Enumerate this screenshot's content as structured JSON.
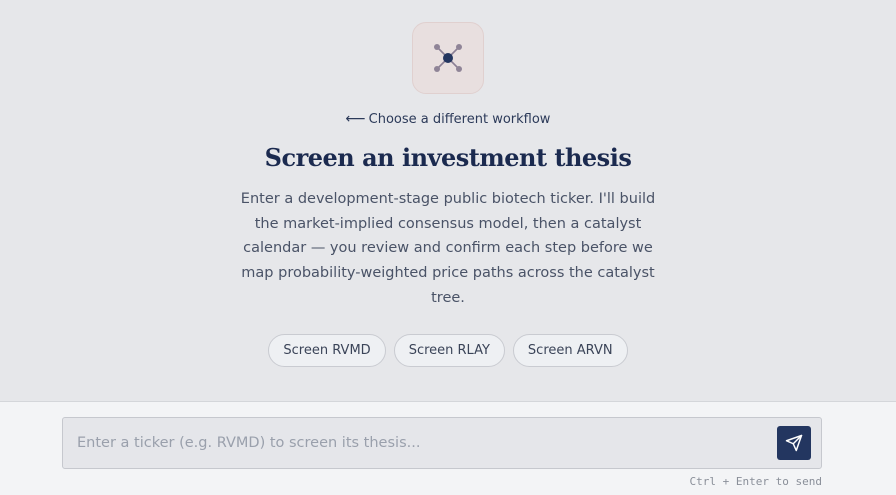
{
  "header": {
    "logo_icon": "network-node-icon",
    "back_arrow": "⟵",
    "back_label": "Choose a different workflow",
    "title": "Screen an investment thesis",
    "description": "Enter a development-stage public biotech ticker. I'll build the market-implied consensus model, then a catalyst calendar — you review and confirm each step before we map probability-weighted price paths across the catalyst tree."
  },
  "suggestions": [
    {
      "label": "Screen RVMD"
    },
    {
      "label": "Screen RLAY"
    },
    {
      "label": "Screen ARVN"
    }
  ],
  "composer": {
    "placeholder": "Enter a ticker (e.g. RVMD) to screen its thesis...",
    "value": "",
    "send_icon": "send-icon",
    "hint": "Ctrl + Enter to send"
  },
  "colors": {
    "background": "#e6e7ea",
    "accent": "#233660",
    "logo_tile": "#e8dfdf"
  }
}
